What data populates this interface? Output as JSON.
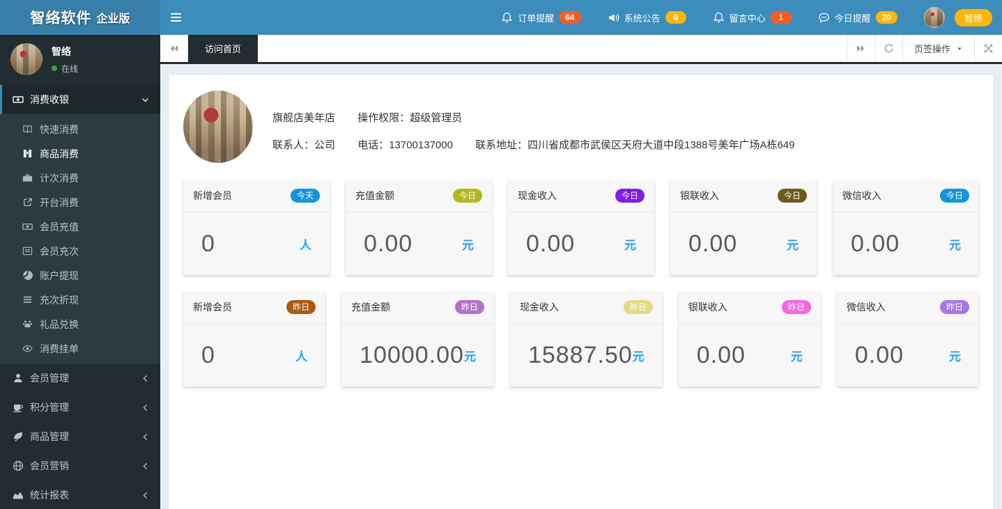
{
  "colors": {
    "header_blue": "#3c8dbc",
    "logo_blue": "#367fa9",
    "sidebar_dark": "#222d32",
    "submenu_dark": "#2c3b41",
    "unit_blue": "#1e9fff",
    "badge_orange": "#ff5a1f",
    "badge_yellow": "#ffb606"
  },
  "header": {
    "logo": {
      "title": "智络软件",
      "edition": "企业版"
    },
    "notifications": [
      {
        "label": "订单提醒",
        "count": "64",
        "badge_color": "#ff5a1f"
      },
      {
        "label": "系统公告",
        "count": "0",
        "badge_color": "#ffb606"
      },
      {
        "label": "留言中心",
        "count": "1",
        "badge_color": "#ff5a1f"
      },
      {
        "label": "今日提醒",
        "count": "20",
        "badge_color": "#ffb606"
      }
    ],
    "user_badge": "智络"
  },
  "sidebar": {
    "user": {
      "name": "智络",
      "status": "在线"
    },
    "menu": [
      {
        "label": "消费收银",
        "state": "open",
        "children": [
          {
            "label": "快速消费"
          },
          {
            "label": "商品消费",
            "active": true
          },
          {
            "label": "计次消费"
          },
          {
            "label": "开台消费"
          },
          {
            "label": "会员充值"
          },
          {
            "label": "会员充次"
          },
          {
            "label": "账户提现"
          },
          {
            "label": "充次折现"
          },
          {
            "label": "礼品兑换"
          },
          {
            "label": "消费挂单"
          }
        ]
      },
      {
        "label": "会员管理"
      },
      {
        "label": "积分管理"
      },
      {
        "label": "商品管理"
      },
      {
        "label": "会员营销"
      },
      {
        "label": "统计报表"
      }
    ]
  },
  "tabbar": {
    "active_tab": "访问首页",
    "actions_label": "页签操作"
  },
  "store": {
    "name": "旗舰店美年店",
    "permission": "操作权限：超级管理员",
    "contact": "联系人：公司",
    "phone": "电话：13700137000",
    "address": "联系地址：四川省成都市武侯区天府大道中段1388号美年广场A栋649"
  },
  "stats": {
    "rows": [
      [
        {
          "title": "新增会员",
          "badge": "今天",
          "badge_color": "#1296db",
          "value": "0",
          "unit": "人"
        },
        {
          "title": "充值金额",
          "badge": "今日",
          "badge_color": "#b2b81d",
          "value": "0.00",
          "unit": "元"
        },
        {
          "title": "现金收入",
          "badge": "今日",
          "badge_color": "#801de8",
          "value": "0.00",
          "unit": "元"
        },
        {
          "title": "银联收入",
          "badge": "今日",
          "badge_color": "#6b5c1e",
          "value": "0.00",
          "unit": "元"
        },
        {
          "title": "微信收入",
          "badge": "今日",
          "badge_color": "#1296db",
          "value": "0.00",
          "unit": "元"
        }
      ],
      [
        {
          "title": "新增会员",
          "badge": "昨日",
          "badge_color": "#ad5a0c",
          "value": "0",
          "unit": "人"
        },
        {
          "title": "充值金额",
          "badge": "昨日",
          "badge_color": "#b273c6",
          "value": "10000.00",
          "unit": "元"
        },
        {
          "title": "现金收入",
          "badge": "昨日",
          "badge_color": "#e2da84",
          "value": "15887.50",
          "unit": "元"
        },
        {
          "title": "银联收入",
          "badge": "昨日",
          "badge_color": "#f667e0",
          "value": "0.00",
          "unit": "元"
        },
        {
          "title": "微信收入",
          "badge": "昨日",
          "badge_color": "#a678e6",
          "value": "0.00",
          "unit": "元"
        }
      ]
    ]
  }
}
